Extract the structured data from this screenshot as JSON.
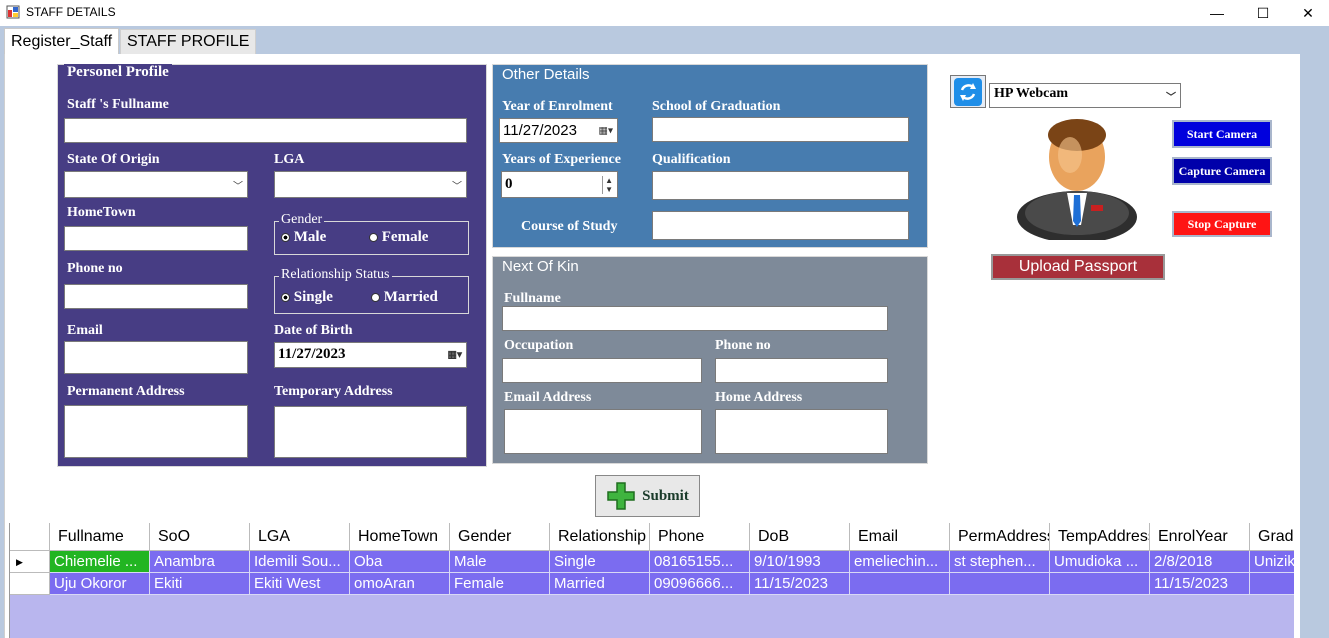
{
  "window": {
    "title": "STAFF DETAILS",
    "minimize": "—",
    "maximize": "☐",
    "close": "✕"
  },
  "tabs": [
    {
      "label": "Register_Staff",
      "active": true
    },
    {
      "label": "STAFF PROFILE",
      "active": false
    }
  ],
  "personel": {
    "legend": "Personel Profile",
    "fullname_label": "Staff 's Fullname",
    "state_label": "State Of Origin",
    "lga_label": "LGA",
    "hometown_label": "HomeTown",
    "gender_legend": "Gender",
    "gender_male": "Male",
    "gender_female": "Female",
    "phone_label": "Phone no",
    "relationship_legend": "Relationship Status",
    "rel_single": "Single",
    "rel_married": "Married",
    "email_label": "Email",
    "dob_label": "Date of Birth",
    "dob_value": "11/27/2023",
    "perm_address_label": "Permanent Address",
    "temp_address_label": "Temporary Address"
  },
  "other": {
    "legend": "Other Details",
    "enrol_label": "Year of Enrolment",
    "enrol_value": "11/27/2023",
    "school_label": "School of Graduation",
    "experience_label": "Years of Experience",
    "experience_value": "0",
    "qualification_label": "Qualification",
    "course_label": "Course of Study"
  },
  "kin": {
    "legend": "Next Of Kin",
    "fullname_label": "Fullname",
    "occupation_label": "Occupation",
    "phone_label": "Phone no",
    "email_label": "Email Address",
    "home_label": "Home Address"
  },
  "camera": {
    "device": "HP Webcam",
    "start": "Start Camera",
    "capture": "Capture Camera",
    "stop": "Stop Capture",
    "upload": "Upload Passport"
  },
  "submit_label": "Submit",
  "colors": {
    "personel_bg": "#473d84",
    "other_bg": "#477caf",
    "kin_bg": "#7e8a99",
    "start_btn": "#0000cc",
    "capture_btn": "#0000aa",
    "stop_btn": "#ff1010",
    "row_selected": "#22b522",
    "row_bg": "#7b6cf0"
  },
  "grid": {
    "columns": [
      "Fullname",
      "SoO",
      "LGA",
      "HomeTown",
      "Gender",
      "Relationship",
      "Phone",
      "DoB",
      "Email",
      "PermAddress",
      "TempAddress",
      "EnrolYear",
      "Grad"
    ],
    "rows": [
      [
        "Chiemelie ...",
        "Anambra",
        "Idemili Sou...",
        "Oba",
        "Male",
        "Single",
        "08165155...",
        "9/10/1993",
        "emeliechin...",
        "st stephen...",
        "Umudioka ...",
        "2/8/2018",
        "Unizik"
      ],
      [
        "Uju Okoror",
        "Ekiti",
        "Ekiti West",
        "omoAran",
        "Female",
        "Married",
        "09096666...",
        "11/15/2023",
        "",
        "",
        "",
        "11/15/2023",
        ""
      ]
    ]
  }
}
